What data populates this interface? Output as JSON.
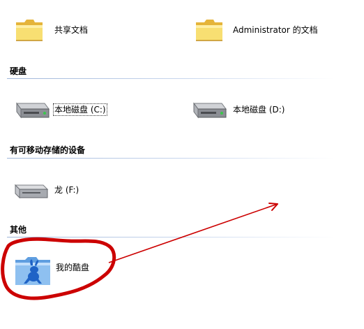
{
  "folders": [
    {
      "label": "共享文档",
      "icon": "folder-icon"
    },
    {
      "label": "Administrator 的文档",
      "icon": "folder-icon"
    }
  ],
  "sections": {
    "hard_disks": {
      "title": "硬盘",
      "items": [
        {
          "label": "本地磁盘 (C:)",
          "icon": "hard-drive-icon"
        },
        {
          "label": "本地磁盘 (D:)",
          "icon": "hard-drive-icon"
        }
      ]
    },
    "removable": {
      "title": "有可移动存储的设备",
      "items": [
        {
          "label": "龙 (F:)",
          "icon": "removable-drive-icon"
        }
      ]
    },
    "other": {
      "title": "其他",
      "items": [
        {
          "label": "我的酷盘",
          "icon": "kanbox-folder-icon"
        }
      ]
    }
  },
  "colors": {
    "folder": "#f3d35a",
    "folder_dark": "#d7a727",
    "divider": "#9fb6d9",
    "annotation": "#cc0000",
    "kanbox_folder": "#7fb4e8",
    "kanbox_rabbit": "#1f63c6"
  }
}
